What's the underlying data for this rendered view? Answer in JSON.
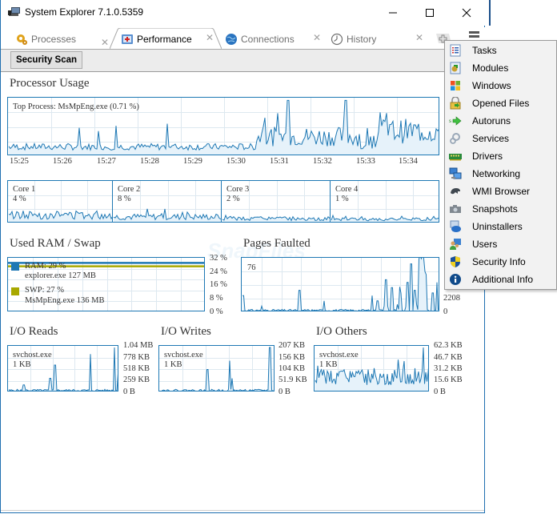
{
  "window": {
    "title": "System Explorer 7.1.0.5359",
    "controls": {
      "minimize": "—",
      "maximize": "☐",
      "close": "✕"
    }
  },
  "tabs": [
    {
      "label": "Processes",
      "icon": "gear-icon",
      "active": false,
      "close": "✕"
    },
    {
      "label": "Performance",
      "icon": "medkit-icon",
      "active": true,
      "close": "✕"
    },
    {
      "label": "Connections",
      "icon": "globe-icon",
      "active": false,
      "close": "✕"
    },
    {
      "label": "History",
      "icon": "clock-icon",
      "active": false,
      "close": "✕"
    }
  ],
  "toolbar": {
    "security_scan_label": "Security Scan"
  },
  "processor": {
    "title": "Processor Usage",
    "top_process": "Top Process: MsMpEng.exe (0.71 %)",
    "time_ticks": [
      "15:25",
      "15:26",
      "15:27",
      "15:28",
      "15:29",
      "15:30",
      "15:31",
      "15:32",
      "15:33",
      "15:34"
    ],
    "cores": [
      {
        "name": "Core 1",
        "value": "4 %"
      },
      {
        "name": "Core 2",
        "value": "8 %"
      },
      {
        "name": "Core 3",
        "value": "2 %"
      },
      {
        "name": "Core 4",
        "value": "1 %"
      }
    ]
  },
  "ram": {
    "title": "Used RAM / Swap",
    "ram_label": "RAM: 29 %",
    "ram_process": "explorer.exe 127 MB",
    "swp_label": "SWP: 27 %",
    "swp_process": "MsMpEng.exe 136 MB",
    "ram_color": "#1e78b4",
    "swp_color": "#a8a800",
    "ram_percent": 29,
    "swp_percent": 27,
    "axis": [
      "32 %",
      "24 %",
      "16 %",
      "8 %",
      "0 %"
    ]
  },
  "pages": {
    "title": "Pages Faulted",
    "current": "76",
    "axis": [
      "2208",
      "0"
    ]
  },
  "io": [
    {
      "title": "I/O Reads",
      "process": "svchost.exe",
      "value": "1 KB",
      "axis": [
        "1.04 MB",
        "778 KB",
        "518 KB",
        "259 KB",
        "0 B"
      ]
    },
    {
      "title": "I/O Writes",
      "process": "svchost.exe",
      "value": "1 KB",
      "axis": [
        "207 KB",
        "156 KB",
        "104 KB",
        "51.9 KB",
        "0 B"
      ]
    },
    {
      "title": "I/O Others",
      "process": "svchost.exe",
      "value": "1 KB",
      "axis": [
        "62.3 KB",
        "46.7 KB",
        "31.2 KB",
        "15.6 KB",
        "0 B"
      ]
    }
  ],
  "menu": {
    "items": [
      {
        "label": "Tasks",
        "icon": "tasks-icon"
      },
      {
        "label": "Modules",
        "icon": "modules-icon"
      },
      {
        "label": "Windows",
        "icon": "windows-icon"
      },
      {
        "label": "Opened Files",
        "icon": "opened-files-icon"
      },
      {
        "label": "Autoruns",
        "icon": "autoruns-icon"
      },
      {
        "label": "Services",
        "icon": "services-icon"
      },
      {
        "label": "Drivers",
        "icon": "drivers-icon"
      },
      {
        "label": "Networking",
        "icon": "networking-icon"
      },
      {
        "label": "WMI Browser",
        "icon": "wmi-icon"
      },
      {
        "label": "Snapshots",
        "icon": "snapshots-icon"
      },
      {
        "label": "Uninstallers",
        "icon": "uninstallers-icon"
      },
      {
        "label": "Users",
        "icon": "users-icon"
      },
      {
        "label": "Security Info",
        "icon": "security-icon"
      },
      {
        "label": "Additional Info",
        "icon": "info-icon"
      }
    ]
  },
  "watermark": "SnapFiles"
}
